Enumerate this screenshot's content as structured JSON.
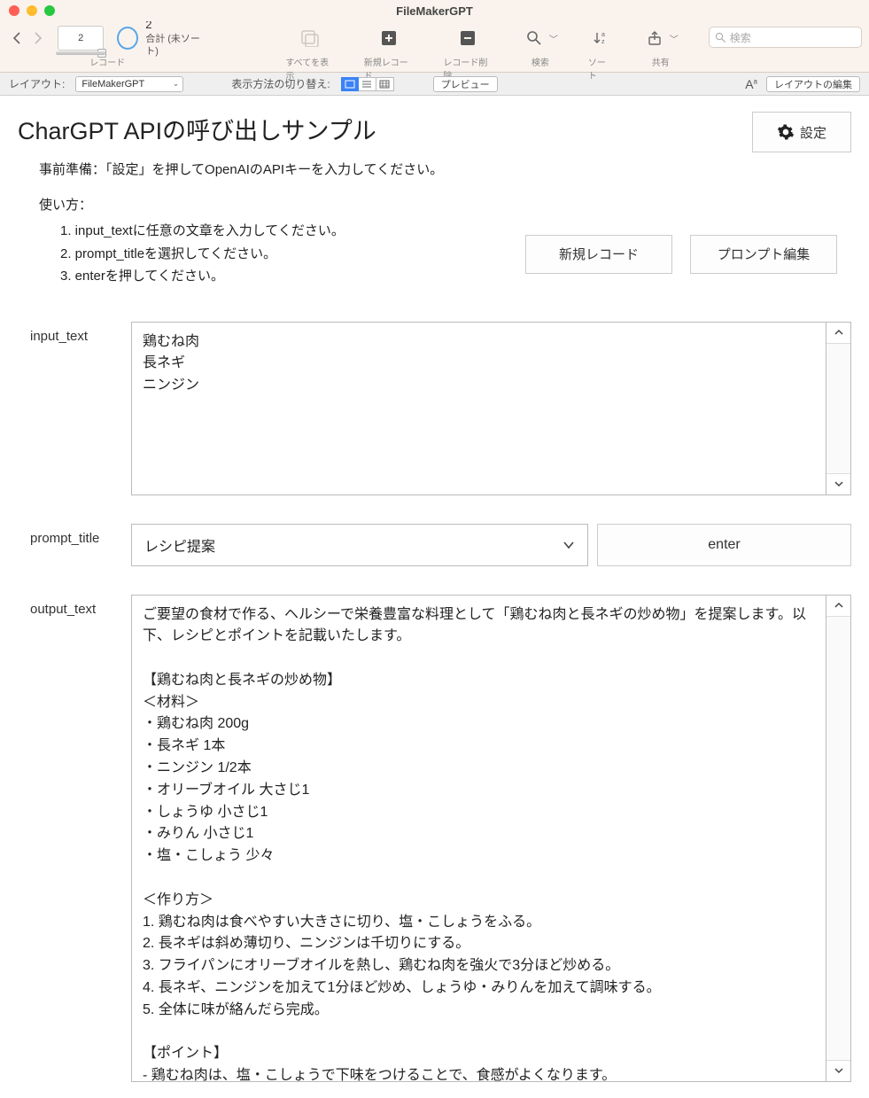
{
  "window": {
    "title": "FileMakerGPT"
  },
  "toolbar": {
    "record_number": "2",
    "total_number": "2",
    "total_label": "合計 (未ソート)",
    "records_label": "レコード",
    "show_all_label": "すべてを表示",
    "new_record_label": "新規レコード",
    "delete_record_label": "レコード削除",
    "find_label": "検索",
    "sort_label": "ソート",
    "share_label": "共有",
    "search_placeholder": "検索"
  },
  "subbar": {
    "layout_label": "レイアウト:",
    "layout_value": "FileMakerGPT",
    "view_label": "表示方法の切り替え:",
    "preview_label": "プレビュー",
    "edit_layout_label": "レイアウトの編集"
  },
  "page": {
    "title": "CharGPT APIの呼び出しサンプル",
    "prep_label": "事前準備：「設定」を押してOpenAIのAPIキーを入力してください。",
    "usage_label": "使い方：",
    "step1": "1. input_textに任意の文章を入力してください。",
    "step2": "2. prompt_titleを選択してください。",
    "step3": "3. enterを押してください。",
    "settings_label": "設定",
    "new_record_btn": "新規レコード",
    "prompt_edit_btn": "プロンプト編集",
    "input_label": "input_text",
    "input_value": "鶏むね肉\n長ネギ\nニンジン",
    "prompt_label": "prompt_title",
    "prompt_value": "レシピ提案",
    "enter_label": "enter",
    "output_label": "output_text",
    "output_value": "ご要望の食材で作る、ヘルシーで栄養豊富な料理として「鶏むね肉と長ネギの炒め物」を提案します。以下、レシピとポイントを記載いたします。\n\n【鶏むね肉と長ネギの炒め物】\n＜材料＞\n・鶏むね肉 200g\n・長ネギ 1本\n・ニンジン 1/2本\n・オリーブオイル 大さじ1\n・しょうゆ 小さじ1\n・みりん 小さじ1\n・塩・こしょう 少々\n\n＜作り方＞\n1. 鶏むね肉は食べやすい大きさに切り、塩・こしょうをふる。\n2. 長ネギは斜め薄切り、ニンジンは千切りにする。\n3. フライパンにオリーブオイルを熱し、鶏むね肉を強火で3分ほど炒める。\n4. 長ネギ、ニンジンを加えて1分ほど炒め、しょうゆ・みりんを加えて調味する。\n5. 全体に味が絡んだら完成。\n\n【ポイント】\n- 鶏むね肉は、塩・こしょうで下味をつけることで、食感がよくなります。"
  }
}
